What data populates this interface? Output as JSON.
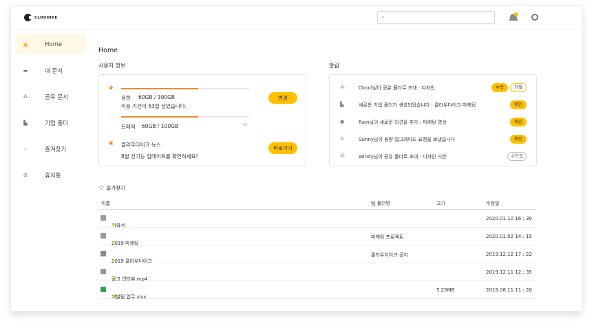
{
  "brand": {
    "name": "CLOUDIKE"
  },
  "search": {
    "placeholder": ""
  },
  "sidebar": {
    "items": [
      {
        "label": "Home",
        "icon": "home-icon",
        "glyph": "▣",
        "active": true
      },
      {
        "label": "내 문서",
        "icon": "folder-icon",
        "glyph": "▬",
        "active": false
      },
      {
        "label": "공유 문서",
        "icon": "shared-users-icon",
        "glyph": "⁂",
        "active": false
      },
      {
        "label": "기업 폴더",
        "icon": "building-icon",
        "glyph": "▙",
        "active": false
      },
      {
        "label": "즐겨찾기",
        "icon": "star-icon",
        "glyph": "☆",
        "active": false
      },
      {
        "label": "휴지통",
        "icon": "trash-icon",
        "glyph": "⊞",
        "active": false
      }
    ]
  },
  "main": {
    "title": "Home",
    "user_section": "사용자 정보",
    "alerts_section": "알림",
    "favorites_section": "즐겨찾기"
  },
  "user_info": {
    "storage_label": "용량",
    "storage_value": "60GB / 100GB",
    "storage_fraction": 0.6,
    "period_text": "이용 기간이 53일 남았습니다.",
    "change_button": "변경",
    "traffic_label": "트래픽",
    "traffic_value": "60GB / 100GB",
    "traffic_fraction": 0.6,
    "news_title": "클라우다이크 뉴스",
    "news_text": "8월 신기능 업데이트를 확인하세요!",
    "go_button": "바로가기"
  },
  "alerts": [
    {
      "icon": "users-icon",
      "glyph": "⁂",
      "text": "Cloud님이 공유 폴더로 초대 : 디자인",
      "actions": [
        {
          "label": "수락",
          "style": "y"
        },
        {
          "label": "거절",
          "style": "o"
        }
      ]
    },
    {
      "icon": "building-icon",
      "glyph": "▙",
      "text": "새로운 기업 폴더가 생성되었습니다 : 클라우다이크 마케팅",
      "actions": [
        {
          "label": "확인",
          "style": "y"
        }
      ]
    },
    {
      "icon": "comment-icon",
      "glyph": "●",
      "text": "Rain님이 새로운 의견을 추가 : 마케팅 영상",
      "actions": [
        {
          "label": "확인",
          "style": "y"
        }
      ]
    },
    {
      "icon": "gear-icon",
      "glyph": "✲",
      "text": "Sunny님이 용량 업그레이드 요청을 보냈습니다",
      "actions": [
        {
          "label": "확인",
          "style": "y"
        }
      ]
    },
    {
      "icon": "users-icon",
      "glyph": "⁂",
      "text": "Windy님이 공유 폴더로 초대 : 디자인 시안",
      "actions": [
        {
          "label": "수락됨",
          "style": "g"
        }
      ]
    }
  ],
  "favorites": {
    "columns": {
      "name": "이름",
      "team": "팀 폴더명",
      "size": "크기",
      "modified": "수정일"
    },
    "rows": [
      {
        "name": "기획서",
        "team": "",
        "size": "",
        "modified": "2020.01.10 16 : 30",
        "icon": "folder-icon",
        "color": "#9a9a9a"
      },
      {
        "name": "2019 마케팅",
        "team": "마케팅 프로젝트",
        "size": "",
        "modified": "2020.01.02 14 : 15",
        "icon": "team-folder-icon",
        "color": "#9a9a9a"
      },
      {
        "name": "2019 클라우다이크",
        "team": "클라우다이크 공지",
        "size": "",
        "modified": "2019.12.12 17 : 22",
        "icon": "team-folder-icon",
        "color": "#8a8a8a"
      },
      {
        "name": "광고 인터뷰.mp4",
        "team": "",
        "size": "",
        "modified": "2019.12.11 12 : 35",
        "icon": "video-file-icon",
        "color": "#9a9a9a"
      },
      {
        "name": "개발팀 업무.xlsx",
        "team": "",
        "size": "5.25MB",
        "modified": "2019.08.11 11 : 20",
        "icon": "excel-file-icon",
        "color": "#2aa84a"
      }
    ]
  },
  "colors": {
    "accent": "#ffc000",
    "progress": "#f08a2a"
  }
}
